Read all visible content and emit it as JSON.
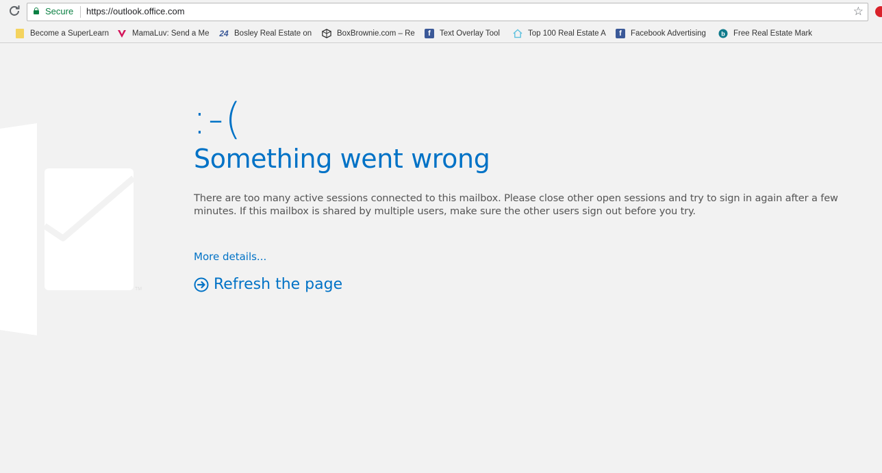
{
  "browser": {
    "reload_icon": "reload-icon",
    "secure_label": "Secure",
    "url": "https://outlook.office.com",
    "star_icon": "star-icon"
  },
  "bookmarks": [
    {
      "label": "Become a SuperLearn",
      "icon": "folder-icon",
      "color": "#f4c542"
    },
    {
      "label": "MamaLuv: Send a Me",
      "icon": "heart-v-icon",
      "color": "#d4145a"
    },
    {
      "label": "Bosley Real Estate on",
      "icon": "24-icon",
      "color": "#3b5998"
    },
    {
      "label": "BoxBrownie.com – Re",
      "icon": "box-icon",
      "color": "#333333"
    },
    {
      "label": "Text Overlay Tool",
      "icon": "facebook-icon",
      "color": "#3b5998"
    },
    {
      "label": "Top 100 Real Estate A",
      "icon": "house-icon",
      "color": "#5bc0de"
    },
    {
      "label": "Facebook Advertising",
      "icon": "facebook-icon",
      "color": "#3b5998"
    },
    {
      "label": "Free Real Estate Mark",
      "icon": "bing-icon",
      "color": "#0e7a8b"
    }
  ],
  "error": {
    "emoticon": ":-(",
    "title": "Something went wrong",
    "message": "There are too many active sessions connected to this mailbox. Please close other open sessions and try to sign in again after a few minutes. If this mailbox is shared by multiple users, make sure the other users sign out before you try.",
    "more_details": "More details...",
    "refresh_label": "Refresh the page"
  },
  "colors": {
    "accent": "#0072c6",
    "background": "#f2f2f2",
    "secure": "#0b8043"
  }
}
